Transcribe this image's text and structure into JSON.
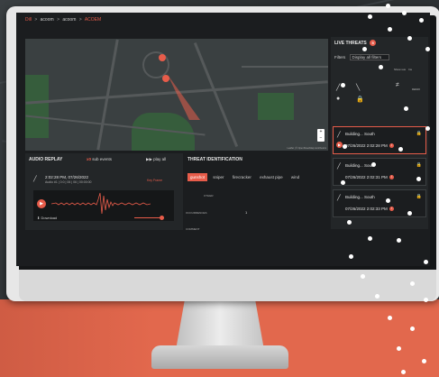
{
  "breadcrumb": [
    "Dill",
    "acoom",
    "acoom",
    "ACOEM"
  ],
  "live_threats": {
    "title": "LIVE THREATS",
    "count": "5",
    "filters_label": "Filters",
    "filters_value": "Display all filters",
    "filter_labels": [
      "Show sus",
      "Ins"
    ],
    "demo_label": "DEMO",
    "cards": [
      {
        "name": "Building... South",
        "time": "07/26/2022 2:02:28 PM"
      },
      {
        "name": "Building... South",
        "time": "07/26/2022 2:02:31 PM"
      },
      {
        "name": "Building... South",
        "time": "07/26/2022 2:02:33 PM"
      }
    ]
  },
  "audio": {
    "title": "AUDIO REPLAY",
    "sub_events": "sub events",
    "sub_events_count": "x0",
    "play_all": "play all",
    "event_time": "2:02:28 PM, 07/26/2022",
    "event_meta": "Audio #1 | 0:0 | 06 | 06 | 00:00:00",
    "key_frame": "Key Frame",
    "download": "Download"
  },
  "threat_id": {
    "title": "THREAT IDENTIFICATION",
    "tabs": [
      "gunshot",
      "sniper",
      "firecracker",
      "exhaust pipe",
      "wind"
    ],
    "labels": [
      "OTHER",
      "OCCURRENCES",
      "COMMENT"
    ],
    "occurrences": "1"
  },
  "map": {
    "attribution": "Leaflet | © OpenStreetMap contributors"
  },
  "colors": {
    "accent": "#e75c4a",
    "screen_bg": "#1b1d1f",
    "panel_bg": "#232628",
    "orange_band": "#e2684d"
  }
}
